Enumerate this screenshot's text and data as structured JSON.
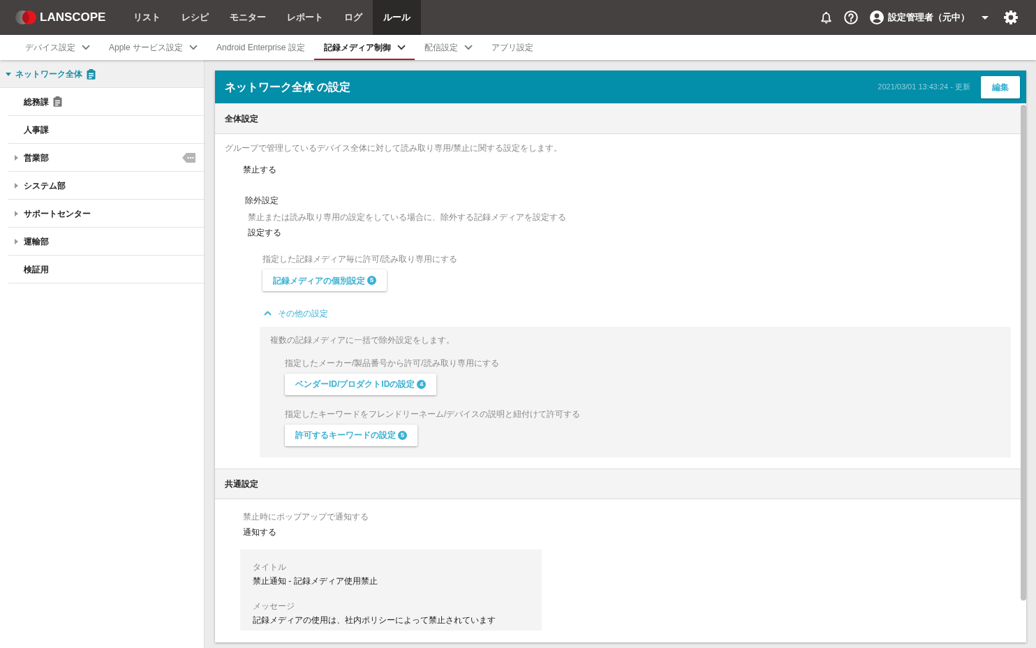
{
  "topbar": {
    "brand": "LANSCOPE",
    "nav": [
      {
        "label": "リスト",
        "selected": false
      },
      {
        "label": "レシピ",
        "selected": false
      },
      {
        "label": "モニター",
        "selected": false
      },
      {
        "label": "レポート",
        "selected": false
      },
      {
        "label": "ログ",
        "selected": false
      },
      {
        "label": "ルール",
        "selected": true
      }
    ],
    "user": "設定管理者（元中）"
  },
  "subnav": [
    {
      "label": "デバイス設定",
      "dropdown": true,
      "selected": false
    },
    {
      "label": "Apple サービス設定",
      "dropdown": true,
      "selected": false
    },
    {
      "label": "Android Enterprise 設定",
      "dropdown": false,
      "selected": false
    },
    {
      "label": "記録メディア制御",
      "dropdown": true,
      "selected": true
    },
    {
      "label": "配信設定",
      "dropdown": true,
      "selected": false
    },
    {
      "label": "アプリ設定",
      "dropdown": false,
      "selected": false
    }
  ],
  "sidebar": {
    "tree": [
      {
        "label": "ネットワーク全体",
        "selected": true,
        "expandable": true,
        "expanded": true,
        "policy": true,
        "tagged": false,
        "children": [
          {
            "label": "総務課",
            "selected": false,
            "expandable": false,
            "policy": true,
            "tagged": false
          },
          {
            "label": "人事課",
            "selected": false,
            "expandable": false,
            "policy": false,
            "tagged": false
          },
          {
            "label": "営業部",
            "selected": false,
            "expandable": true,
            "expanded": false,
            "policy": false,
            "tagged": true
          },
          {
            "label": "システム部",
            "selected": false,
            "expandable": true,
            "expanded": false,
            "policy": false,
            "tagged": false
          },
          {
            "label": "サポートセンター",
            "selected": false,
            "expandable": true,
            "expanded": false,
            "policy": false,
            "tagged": false
          },
          {
            "label": "運輸部",
            "selected": false,
            "expandable": true,
            "expanded": false,
            "policy": false,
            "tagged": false
          },
          {
            "label": "検証用",
            "selected": false,
            "expandable": false,
            "policy": false,
            "tagged": false
          }
        ]
      }
    ]
  },
  "panel": {
    "title": "ネットワーク全体 の設定",
    "updated": "2021/03/01 13:43:24 - 更新",
    "edit": "編集",
    "sections": [
      {
        "heading": "全体設定",
        "blocks": [
          {
            "kind": "note",
            "text": "グループで管理しているデバイス全体に対して読み取り専用/禁止に関する設定をします。"
          },
          {
            "kind": "group",
            "children": [
              {
                "kind": "value",
                "text": "禁止する"
              },
              {
                "kind": "group",
                "children": [
                  {
                    "kind": "heading",
                    "text": "除外設定"
                  },
                  {
                    "kind": "group",
                    "children": [
                      {
                        "kind": "note",
                        "text": "禁止または読み取り専用の設定をしている場合に、除外する記録メディアを設定する"
                      },
                      {
                        "kind": "value",
                        "text": "設定する"
                      },
                      {
                        "kind": "group",
                        "children": [
                          {
                            "kind": "option",
                            "note": "指定した記録メディア毎に許可/読み取り専用にする",
                            "button": "記録メディアの個別設定",
                            "count": "5"
                          },
                          {
                            "kind": "collapse",
                            "label": "その他の設定",
                            "expanded": true,
                            "children": [
                              {
                                "kind": "note",
                                "text": "複数の記録メディアに一括で除外設定をします。"
                              },
                              {
                                "kind": "group",
                                "children": [
                                  {
                                    "kind": "option",
                                    "note": "指定したメーカー/製品番号から許可/読み取り専用にする",
                                    "button": "ベンダーID/プロダクトIDの設定",
                                    "count": "4"
                                  },
                                  {
                                    "kind": "option",
                                    "note": "指定したキーワードをフレンドリーネーム/デバイスの説明と紐付けて許可する",
                                    "button": "許可するキーワードの設定",
                                    "count": "5"
                                  }
                                ]
                              }
                            ]
                          }
                        ]
                      }
                    ]
                  }
                ]
              }
            ]
          }
        ]
      },
      {
        "heading": "共通設定",
        "blocks": [
          {
            "kind": "group",
            "children": [
              {
                "kind": "note",
                "text": "禁止時にポップアップで通知する"
              },
              {
                "kind": "value",
                "text": "通知する"
              },
              {
                "kind": "box",
                "children": [
                  {
                    "kind": "field",
                    "label": "タイトル",
                    "value": "禁止通知 - 記録メディア使用禁止"
                  },
                  {
                    "kind": "field",
                    "label": "メッセージ",
                    "value": "記録メディアの使用は、社内ポリシーによって禁止されています"
                  }
                ]
              }
            ]
          }
        ]
      }
    ]
  }
}
